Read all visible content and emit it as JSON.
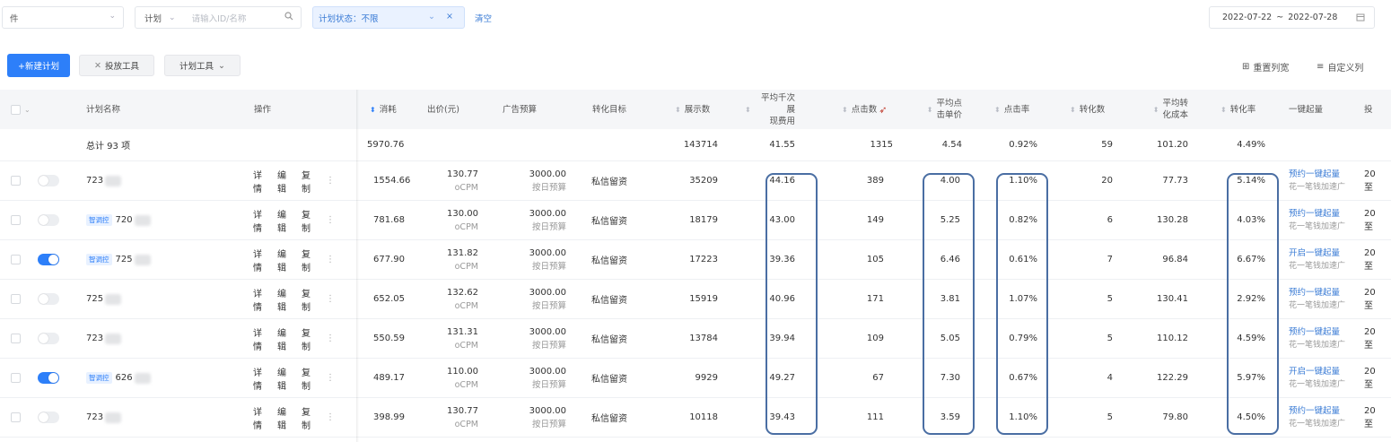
{
  "filters": {
    "object_select": "件",
    "plan_select": "计划",
    "search_placeholder": "请输入ID/名称",
    "status_chip": "计划状态：不限",
    "clear_label": "清空",
    "date_start": "2022-07-22",
    "date_sep": "~",
    "date_end": "2022-07-28"
  },
  "toolbar": {
    "new_plan": "+新建计划",
    "delivery_tool": "投放工具",
    "plan_tool": "计划工具",
    "reset_width": "重置列宽",
    "custom_columns": "自定义列"
  },
  "columns": {
    "name": "计划名称",
    "ops": "操作",
    "cost": "消耗",
    "bid": "出价(元)",
    "budget": "广告预算",
    "goal": "转化目标",
    "impressions": "展示数",
    "cpm_1": "平均千次展",
    "cpm_2": "现费用",
    "clicks": "点击数",
    "cpc_1": "平均点",
    "cpc_2": "击单价",
    "ctr": "点击率",
    "conversions": "转化数",
    "cpa_1": "平均转",
    "cpa_2": "化成本",
    "cvr": "转化率",
    "one_click": "一键起量",
    "last": "投"
  },
  "summary": {
    "label": "总计 93 项",
    "cost": "5970.76",
    "impressions": "143714",
    "cpm": "41.55",
    "clicks": "1315",
    "cpc": "4.54",
    "ctr": "0.92%",
    "conversions": "59",
    "cpa": "101.20",
    "cvr": "4.49%"
  },
  "ops_labels": {
    "detail": "详情",
    "edit": "编辑",
    "copy": "复制",
    "more": "⋮"
  },
  "tag_label": "智调控",
  "rows": [
    {
      "toggle": false,
      "tag": false,
      "name": "723",
      "cost": "1554.66",
      "bid": "130.77",
      "bid_type": "oCPM",
      "budget": "3000.00",
      "budget_type": "按日预算",
      "goal": "私信留资",
      "impressions": "35209",
      "cpm": "44.16",
      "clicks": "389",
      "cpc": "4.00",
      "ctr": "1.10%",
      "conversions": "20",
      "cpa": "77.73",
      "cvr": "5.14%",
      "action": "预约一键起量",
      "action_hint": "花一笔钱加速广",
      "last1": "20",
      "last2": "至"
    },
    {
      "toggle": false,
      "tag": true,
      "name": "720",
      "cost": "781.68",
      "bid": "130.00",
      "bid_type": "oCPM",
      "budget": "3000.00",
      "budget_type": "按日预算",
      "goal": "私信留资",
      "impressions": "18179",
      "cpm": "43.00",
      "clicks": "149",
      "cpc": "5.25",
      "ctr": "0.82%",
      "conversions": "6",
      "cpa": "130.28",
      "cvr": "4.03%",
      "action": "预约一键起量",
      "action_hint": "花一笔钱加速广",
      "last1": "20",
      "last2": "至"
    },
    {
      "toggle": true,
      "tag": true,
      "name": "725",
      "cost": "677.90",
      "bid": "131.82",
      "bid_type": "oCPM",
      "budget": "3000.00",
      "budget_type": "按日预算",
      "goal": "私信留资",
      "impressions": "17223",
      "cpm": "39.36",
      "clicks": "105",
      "cpc": "6.46",
      "ctr": "0.61%",
      "conversions": "7",
      "cpa": "96.84",
      "cvr": "6.67%",
      "action": "开启一键起量",
      "action_hint": "花一笔钱加速广",
      "last1": "20",
      "last2": "至"
    },
    {
      "toggle": false,
      "tag": false,
      "name": "725",
      "cost": "652.05",
      "bid": "132.62",
      "bid_type": "oCPM",
      "budget": "3000.00",
      "budget_type": "按日预算",
      "goal": "私信留资",
      "impressions": "15919",
      "cpm": "40.96",
      "clicks": "171",
      "cpc": "3.81",
      "ctr": "1.07%",
      "conversions": "5",
      "cpa": "130.41",
      "cvr": "2.92%",
      "action": "预约一键起量",
      "action_hint": "花一笔钱加速广",
      "last1": "20",
      "last2": "至"
    },
    {
      "toggle": false,
      "tag": false,
      "name": "723",
      "cost": "550.59",
      "bid": "131.31",
      "bid_type": "oCPM",
      "budget": "3000.00",
      "budget_type": "按日预算",
      "goal": "私信留资",
      "impressions": "13784",
      "cpm": "39.94",
      "clicks": "109",
      "cpc": "5.05",
      "ctr": "0.79%",
      "conversions": "5",
      "cpa": "110.12",
      "cvr": "4.59%",
      "action": "预约一键起量",
      "action_hint": "花一笔钱加速广",
      "last1": "20",
      "last2": "至"
    },
    {
      "toggle": true,
      "tag": true,
      "name": "626",
      "cost": "489.17",
      "bid": "110.00",
      "bid_type": "oCPM",
      "budget": "3000.00",
      "budget_type": "按日预算",
      "goal": "私信留资",
      "impressions": "9929",
      "cpm": "49.27",
      "clicks": "67",
      "cpc": "7.30",
      "ctr": "0.67%",
      "conversions": "4",
      "cpa": "122.29",
      "cvr": "5.97%",
      "action": "开启一键起量",
      "action_hint": "花一笔钱加速广",
      "last1": "20",
      "last2": "至"
    },
    {
      "toggle": false,
      "tag": false,
      "name": "723",
      "cost": "398.99",
      "bid": "130.77",
      "bid_type": "oCPM",
      "budget": "3000.00",
      "budget_type": "按日预算",
      "goal": "私信留资",
      "impressions": "10118",
      "cpm": "39.43",
      "clicks": "111",
      "cpc": "3.59",
      "ctr": "1.10%",
      "conversions": "5",
      "cpa": "79.80",
      "cvr": "4.50%",
      "action": "预约一键起量",
      "action_hint": "花一笔钱加速广",
      "last1": "20",
      "last2": "至"
    }
  ]
}
